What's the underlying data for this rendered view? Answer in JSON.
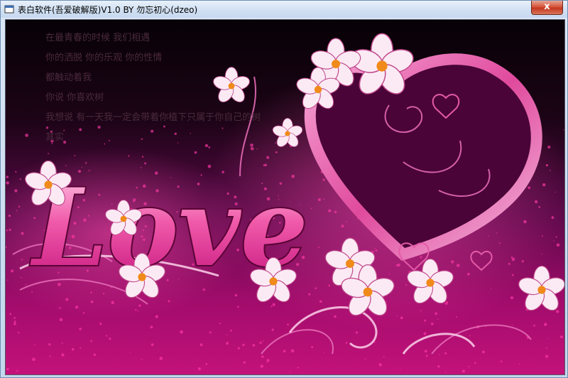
{
  "window": {
    "title": "表白软件(吾爱破解版)V1.0  BY 勿忘初心(dzeo)",
    "close_label": "x"
  },
  "poem": {
    "lines": [
      "在最青春的时候 我们相遇",
      "你的洒脱 你的乐观 你的性情",
      "都触动着我",
      "你说 你喜欢树",
      "我想说 有一天我一定会带着你植下只属于你自己的树",
      "其实"
    ]
  },
  "artwork": {
    "word": "Love"
  },
  "colors": {
    "background_top": "#0b0208",
    "background_bottom": "#d4107e",
    "heart_pink": "#e0409a",
    "petal": "#fbe8f3",
    "flower_center": "#f08a1a"
  },
  "icons": {
    "app": "window-app-icon",
    "close": "close-icon"
  }
}
